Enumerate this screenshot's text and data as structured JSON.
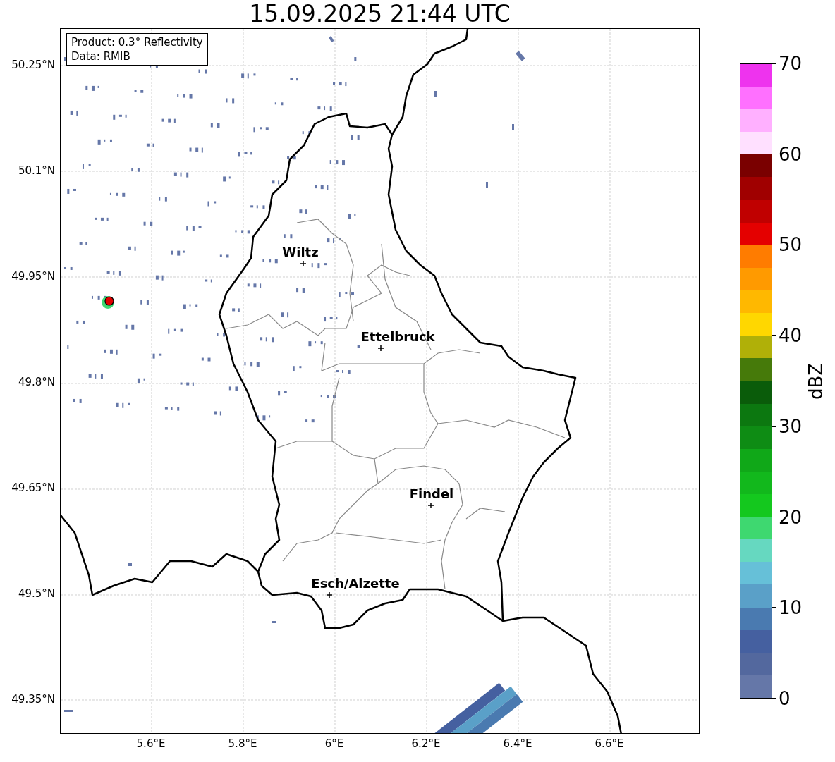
{
  "title": "15.09.2025 21:44 UTC",
  "info_box": {
    "lines": [
      "Product: 0.3° Reflectivity",
      "Data: RMIB"
    ]
  },
  "lat_labels": [
    "50.25°N",
    "50.1°N",
    "49.95°N",
    "49.8°N",
    "49.65°N",
    "49.5°N",
    "49.35°N"
  ],
  "lon_labels": [
    "5.6°E",
    "5.8°E",
    "6°E",
    "6.2°E",
    "6.4°E",
    "6.6°E"
  ],
  "cities": [
    {
      "name": "Wiltz"
    },
    {
      "name": "Ettelbruck"
    },
    {
      "name": "Findel"
    },
    {
      "name": "Esch/Alzette"
    }
  ],
  "colorbar": {
    "label": "dBZ",
    "ticks": [
      "70",
      "60",
      "50",
      "40",
      "30",
      "20",
      "10",
      "0"
    ],
    "bands": [
      {
        "color": "#6577a8"
      },
      {
        "color": "#53689e"
      },
      {
        "color": "#4560a0"
      },
      {
        "color": "#4a7ab0"
      },
      {
        "color": "#5aa0c8"
      },
      {
        "color": "#66c0d8"
      },
      {
        "color": "#66d8c0"
      },
      {
        "color": "#3ed870"
      },
      {
        "color": "#14c81e"
      },
      {
        "color": "#12b81c"
      },
      {
        "color": "#10a818"
      },
      {
        "color": "#0e8c14"
      },
      {
        "color": "#0c7810"
      },
      {
        "color": "#0a5c0a"
      },
      {
        "color": "#467a0a"
      },
      {
        "color": "#b0b008"
      },
      {
        "color": "#ffd700"
      },
      {
        "color": "#ffb800"
      },
      {
        "color": "#ff9a00"
      },
      {
        "color": "#ff7c00"
      },
      {
        "color": "#e40000"
      },
      {
        "color": "#c00000"
      },
      {
        "color": "#a00000"
      },
      {
        "color": "#7a0000"
      },
      {
        "color": "#ffe0ff"
      },
      {
        "color": "#ffb0ff"
      },
      {
        "color": "#ff70ff"
      },
      {
        "color": "#ee33ee"
      }
    ]
  }
}
